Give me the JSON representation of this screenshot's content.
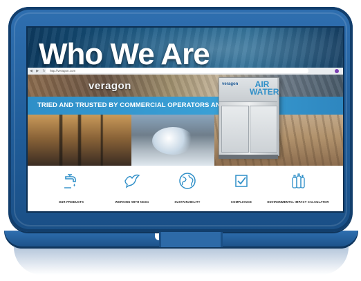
{
  "hero": {
    "title": "Who We Are"
  },
  "browser": {
    "url": "http://veragon.com"
  },
  "site": {
    "brand": "veragon",
    "tagline": "TRIED AND TRUSTED BY COMMERCIAL OPERATORS AND NGO`S GLOB",
    "product_badge": {
      "brand": "veragon",
      "text": "AIR WATER"
    }
  },
  "features": [
    {
      "label": "OUR PRODUCTS",
      "icon": "water-tap-icon"
    },
    {
      "label": "WORKING WITH NGOs",
      "icon": "dove-icon"
    },
    {
      "label": "SUSTAINABILITY",
      "icon": "globe-icon"
    },
    {
      "label": "COMPLIANCE",
      "icon": "checkbox-icon"
    },
    {
      "label": "ENVIRONMENTAL IMPACT CALCULATOR",
      "icon": "bottles-icon"
    }
  ],
  "colors": {
    "laptop": "#2f6fb0",
    "accent": "#2f8fc8",
    "icon": "#2f8fc8"
  }
}
